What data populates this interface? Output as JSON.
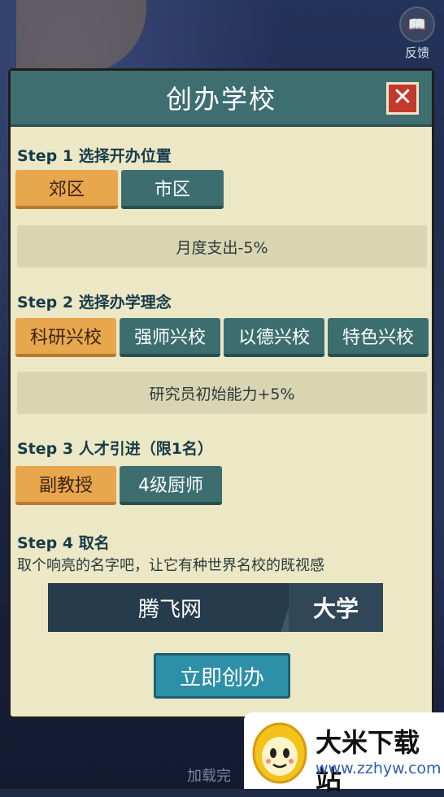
{
  "feedback": {
    "label": "反馈"
  },
  "loading": {
    "text": "加载完"
  },
  "dialog": {
    "title": "创办学校"
  },
  "step1": {
    "title": "Step 1 选择开办位置",
    "options": [
      "郊区",
      "市区"
    ],
    "selected_index": 0,
    "info": "月度支出-5%"
  },
  "step2": {
    "title": "Step 2 选择办学理念",
    "options": [
      "科研兴校",
      "强师兴校",
      "以德兴校",
      "特色兴校"
    ],
    "selected_index": 0,
    "info": "研究员初始能力+5%"
  },
  "step3": {
    "title": "Step 3 人才引进（限1名）",
    "options": [
      "副教授",
      "4级厨师"
    ],
    "selected_index": 0
  },
  "step4": {
    "title": "Step 4 取名",
    "subtitle": "取个响亮的名字吧，让它有种世界名校的既视感",
    "name_value": "腾飞网",
    "name_suffix": "大学"
  },
  "create_button": "立即创办",
  "watermark": {
    "title": "大米下载站",
    "url": "www.zzhyw.com"
  }
}
